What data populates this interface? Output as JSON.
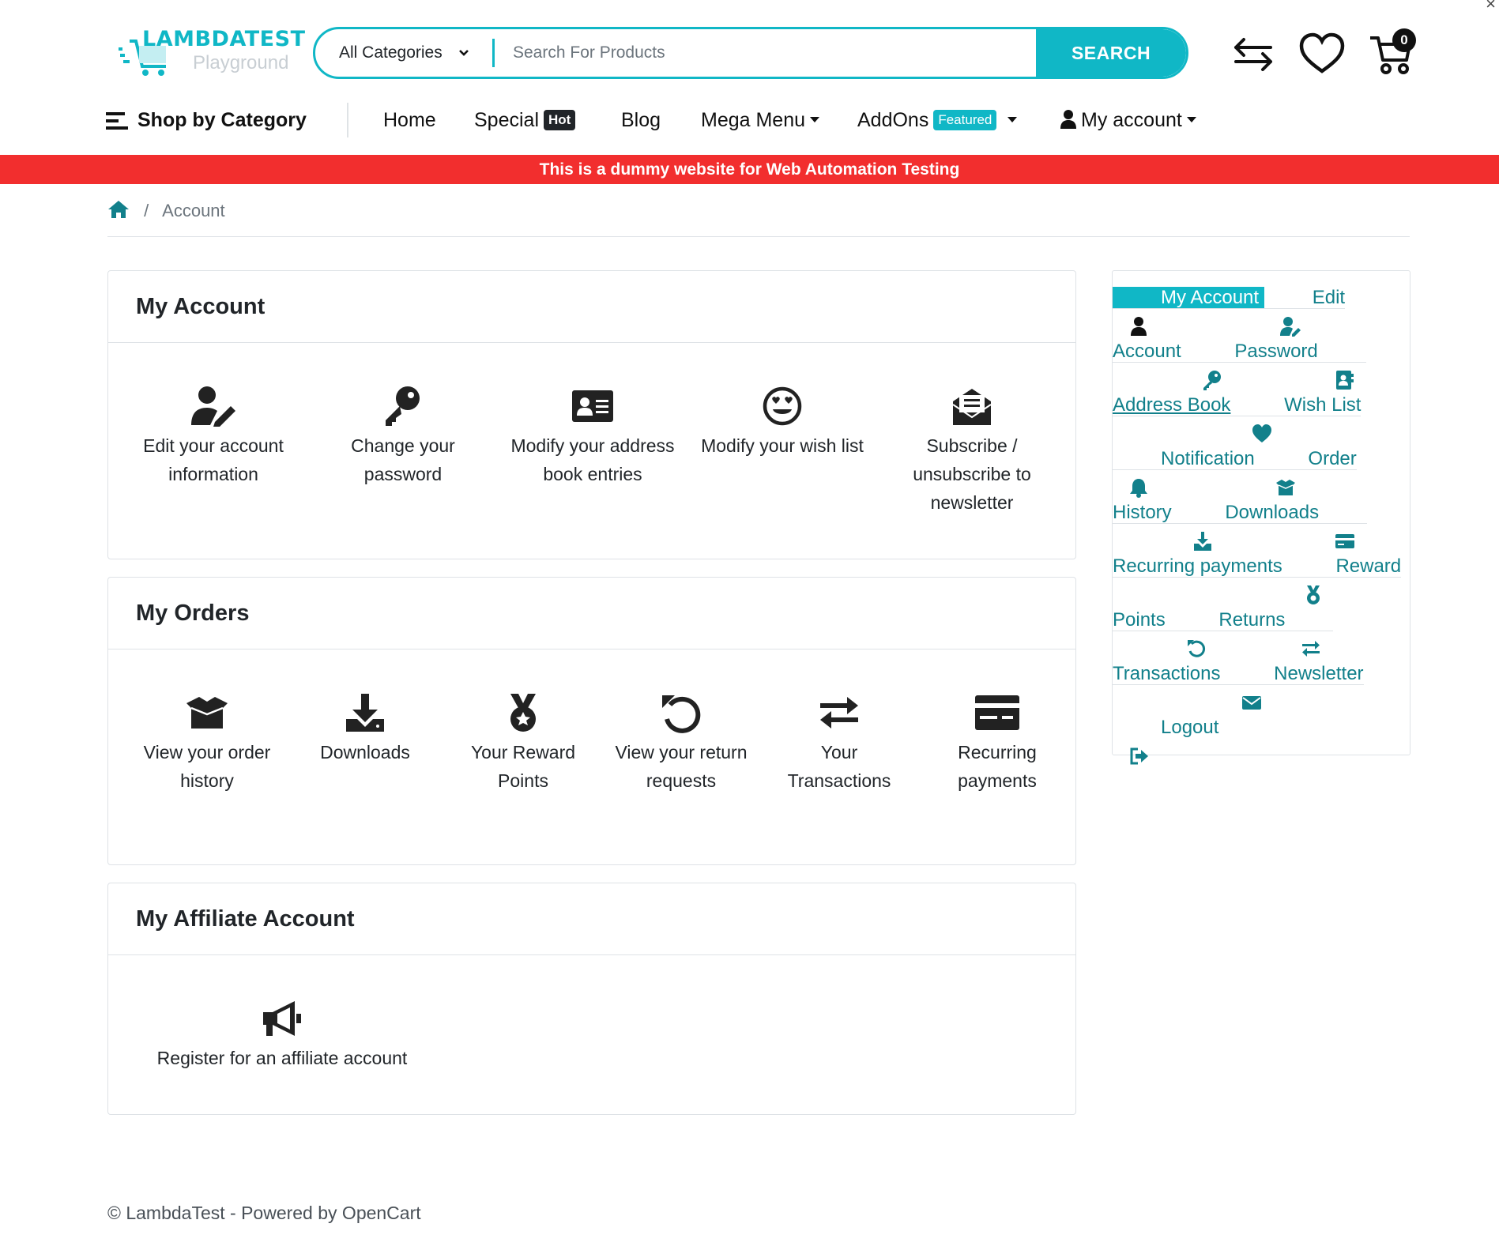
{
  "header": {
    "brand": "LAMBDATEST",
    "brand_sub": "Playground",
    "search": {
      "category": "All Categories",
      "placeholder": "Search For Products",
      "button": "SEARCH"
    },
    "cart_count": "0",
    "icons": [
      "compare-icon",
      "wishlist-heart-icon",
      "cart-icon"
    ]
  },
  "nav": {
    "shop_by_category": "Shop by Category",
    "items": [
      {
        "label": "Home"
      },
      {
        "label": "Special",
        "badge": "Hot"
      },
      {
        "label": "Blog"
      },
      {
        "label": "Mega Menu"
      },
      {
        "label": "AddOns",
        "badge": "Featured"
      },
      {
        "label": "My account"
      }
    ]
  },
  "banner": "This is a dummy website for Web Automation Testing",
  "breadcrumb": {
    "current": "Account"
  },
  "my_account": {
    "title": "My Account",
    "tiles": [
      {
        "label": "Edit your account information",
        "icon": "user-edit-icon"
      },
      {
        "label": "Change your password",
        "icon": "key-icon"
      },
      {
        "label": "Modify your address book entries",
        "icon": "address-card-icon"
      },
      {
        "label": "Modify your wish list",
        "icon": "heart-eyes-icon"
      },
      {
        "label": "Subscribe / unsubscribe to newsletter",
        "icon": "envelope-open-icon"
      }
    ]
  },
  "my_orders": {
    "title": "My Orders",
    "tiles": [
      {
        "label": "View your order history",
        "icon": "box-open-icon"
      },
      {
        "label": "Downloads",
        "icon": "download-icon"
      },
      {
        "label": "Your Reward Points",
        "icon": "medal-icon"
      },
      {
        "label": "View your return requests",
        "icon": "undo-icon"
      },
      {
        "label": "Your Transactions",
        "icon": "exchange-icon"
      },
      {
        "label": "Recurring payments",
        "icon": "credit-card-icon"
      }
    ]
  },
  "my_affiliate": {
    "title": "My Affiliate Account",
    "tiles": [
      {
        "label": "Register for an affiliate account",
        "icon": "bullhorn-icon"
      }
    ]
  },
  "sidebar": {
    "items": [
      {
        "label": "My Account",
        "active": true
      },
      {
        "label": "Edit Account"
      },
      {
        "label": "Password"
      },
      {
        "label": "Address Book",
        "hover": true
      },
      {
        "label": "Wish List"
      },
      {
        "label": "Notification"
      },
      {
        "label": "Order History"
      },
      {
        "label": "Downloads"
      },
      {
        "label": "Recurring payments"
      },
      {
        "label": "Reward Points"
      },
      {
        "label": "Returns"
      },
      {
        "label": "Transactions"
      },
      {
        "label": "Newsletter"
      },
      {
        "label": "Logout"
      }
    ]
  },
  "footer": "© LambdaTest - Powered by OpenCart",
  "colors": {
    "accent": "#10b7c6",
    "banner": "#f22e2e",
    "sidebar_link": "#12808b"
  }
}
